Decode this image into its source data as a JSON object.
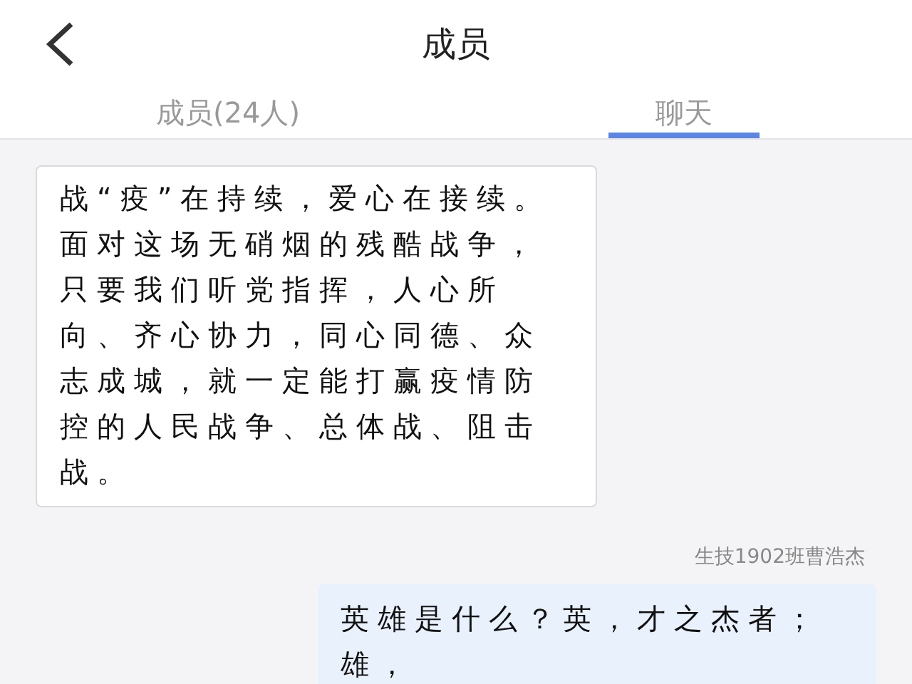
{
  "header": {
    "title": "成员"
  },
  "tabs": [
    {
      "label": "成员(24人)",
      "selected": false
    },
    {
      "label": "聊天",
      "selected": true
    }
  ],
  "messages": [
    {
      "kind": "received",
      "text": "战“疫”在持续，爱心在接续。面对这场无硝烟的残酷战争，只要我们听党指挥，人心所向、齐心协力，同心同德、众志成城，就一定能打赢疫情防控的人民战争、总体战、阻击战。"
    },
    {
      "kind": "sent",
      "sender": "生技1902班曹浩杰",
      "text": "英雄是什么？英，才之杰者；雄，"
    }
  ]
}
